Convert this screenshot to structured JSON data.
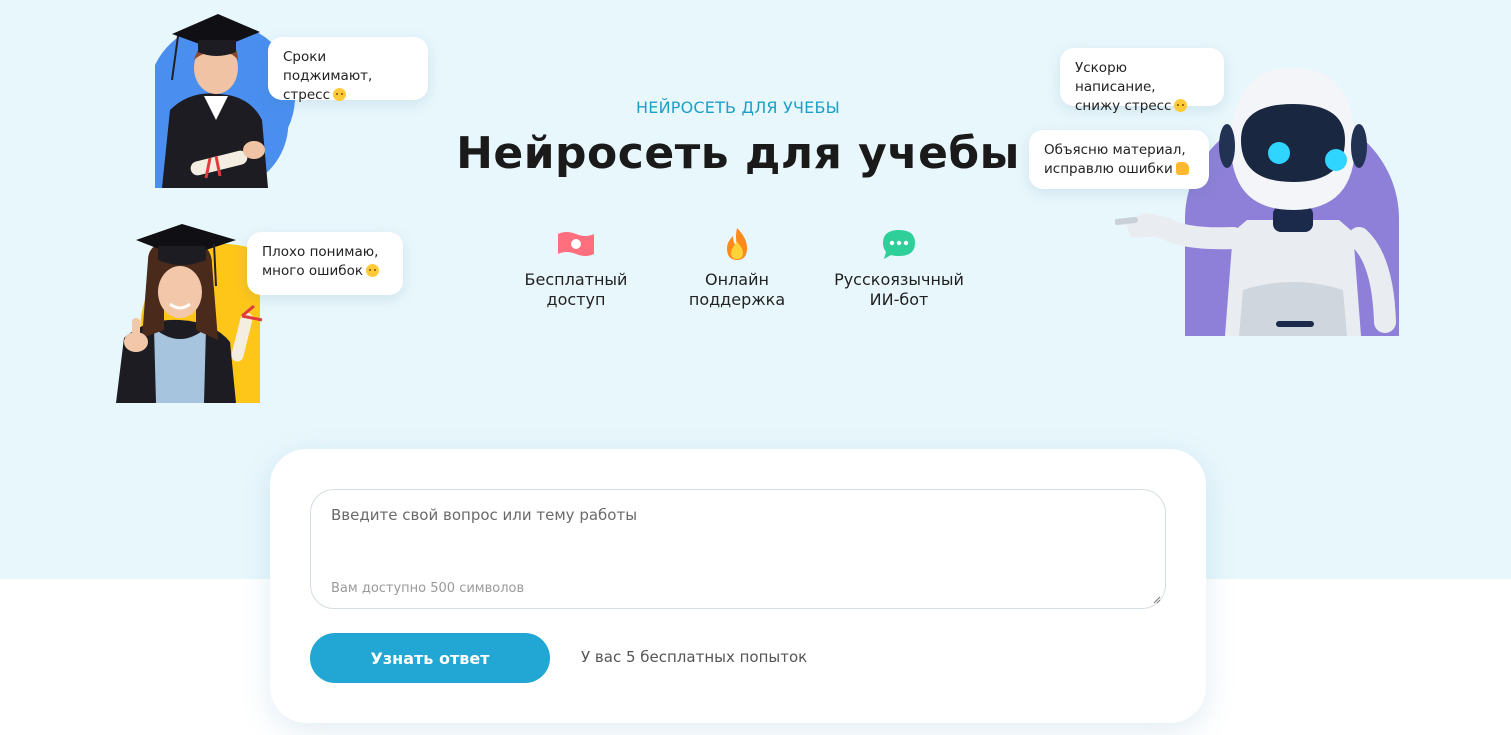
{
  "hero": {
    "kicker": "НЕЙРОСЕТЬ ДЛЯ УЧЕБЫ",
    "title": "Нейросеть для учебы",
    "features": [
      {
        "line1": "Бесплатный",
        "line2": "доступ",
        "icon": "banknote-icon"
      },
      {
        "line1": "Онлайн",
        "line2": "поддержка",
        "icon": "flame-icon"
      },
      {
        "line1": "Русскоязычный",
        "line2": "ИИ-бот",
        "icon": "chat-bubble-icon"
      }
    ],
    "bubbles": {
      "student_1": {
        "line1": "Сроки поджимают,",
        "line2": "стресс"
      },
      "student_2": {
        "line1": "Плохо понимаю,",
        "line2": "много ошибок"
      },
      "robot_1": {
        "line1": "Ускорю написание,",
        "line2": "снижу стресс"
      },
      "robot_2": {
        "line1": "Объясню материал,",
        "line2": "исправлю ошибки"
      }
    }
  },
  "form": {
    "placeholder": "Введите свой вопрос или тему работы",
    "value": "",
    "char_limit": "Вам доступно 500 символов",
    "submit_label": "Узнать ответ",
    "attempts": "У вас 5 бесплатных попыток"
  },
  "colors": {
    "hero_bg": "#e8f7fc",
    "accent": "#22a7d4",
    "kicker": "#1e9fc8",
    "student_1_circle": "#4a8ff0",
    "student_2_circle": "#ffc61a",
    "robot_circle": "#8e80d8"
  }
}
